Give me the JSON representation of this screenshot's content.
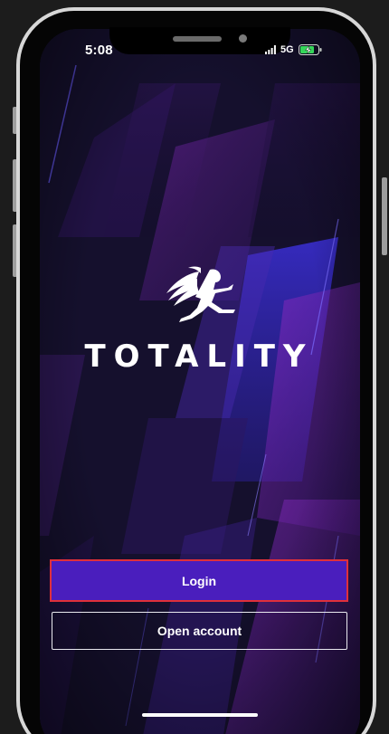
{
  "status_bar": {
    "time": "5:08",
    "network": "5G",
    "battery_charging": true
  },
  "brand": {
    "name": "TOTALITY",
    "logo_icon": "winged-figure-logo"
  },
  "actions": {
    "login_label": "Login",
    "open_account_label": "Open account"
  },
  "colors": {
    "login_button_bg": "#4a1ebd",
    "login_button_border": "#e0303a",
    "background_dark": "#120f26",
    "accent_purple": "#7a1fb0",
    "accent_blue": "#3a2fd0"
  }
}
